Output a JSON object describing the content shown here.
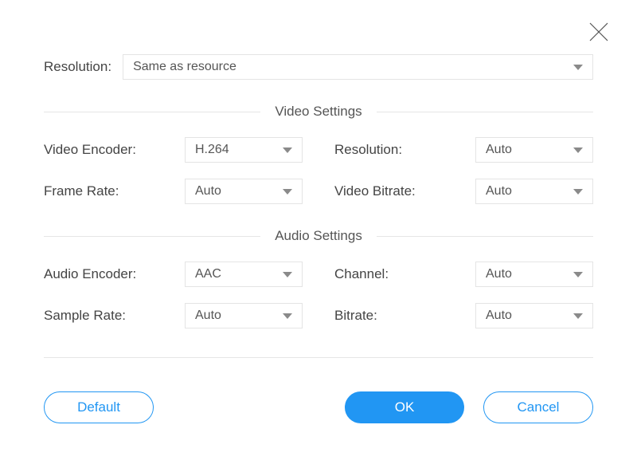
{
  "top": {
    "label": "Resolution:",
    "value": "Same as resource"
  },
  "video": {
    "title": "Video Settings",
    "encoder": {
      "label": "Video Encoder:",
      "value": "H.264"
    },
    "resolution": {
      "label": "Resolution:",
      "value": "Auto"
    },
    "framerate": {
      "label": "Frame Rate:",
      "value": "Auto"
    },
    "bitrate": {
      "label": "Video Bitrate:",
      "value": "Auto"
    }
  },
  "audio": {
    "title": "Audio Settings",
    "encoder": {
      "label": "Audio Encoder:",
      "value": "AAC"
    },
    "channel": {
      "label": "Channel:",
      "value": "Auto"
    },
    "samplerate": {
      "label": "Sample Rate:",
      "value": "Auto"
    },
    "bitrate": {
      "label": "Bitrate:",
      "value": "Auto"
    }
  },
  "buttons": {
    "default": "Default",
    "ok": "OK",
    "cancel": "Cancel"
  }
}
